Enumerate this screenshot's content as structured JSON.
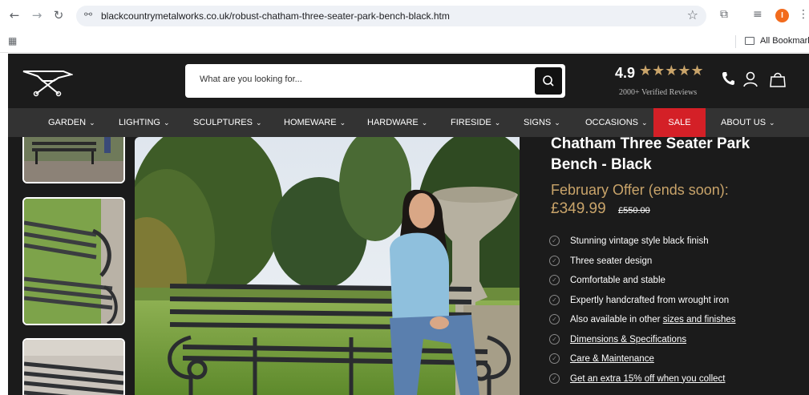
{
  "browser": {
    "url": "blackcountrymetalworks.co.uk/robust-chatham-three-seater-park-bench-black.htm",
    "bookmarks_label": "All Bookmarks",
    "profile_initial": "I"
  },
  "header": {
    "search_placeholder": "What are you looking for...",
    "rating_value": "4.9",
    "rating_stars": "★★★★★",
    "reviews_label": "2000+ Verified Reviews"
  },
  "nav": {
    "items": [
      "GARDEN",
      "LIGHTING",
      "SCULPTURES",
      "HOMEWARE",
      "HARDWARE",
      "FIRESIDE",
      "SIGNS",
      "OCCASIONS",
      "SALE",
      "ABOUT US"
    ]
  },
  "product": {
    "title_line1": "Chatham Three Seater Park",
    "title_line2": "Bench - Black",
    "offer": "February Offer (ends soon):",
    "price": "£349.99",
    "old_price": "£550.00",
    "features": [
      {
        "text": "Stunning vintage style black finish"
      },
      {
        "text": "Three seater design"
      },
      {
        "text": "Comfortable and stable"
      },
      {
        "text": "Expertly handcrafted from wrought iron"
      },
      {
        "text": "Also available in other ",
        "link": "sizes and finishes"
      },
      {
        "link": "Dimensions & Specifications"
      },
      {
        "link": "Care & Maintenance"
      },
      {
        "link": "Get an extra 15% off when you collect"
      }
    ]
  },
  "colors": {
    "accent_gold": "#c9a46a",
    "sale_red": "#d42027",
    "header_bg": "#1b1b1b",
    "nav_bg": "#333333"
  },
  "icons": [
    "back-arrow-icon",
    "forward-arrow-icon",
    "reload-icon",
    "site-info-icon",
    "bookmark-star-icon",
    "extensions-icon",
    "reading-list-icon",
    "kebab-menu-icon",
    "apps-icon",
    "folder-icon",
    "anvil-logo",
    "search-icon",
    "phone-icon",
    "user-icon",
    "bag-icon",
    "check-circle-icon"
  ]
}
